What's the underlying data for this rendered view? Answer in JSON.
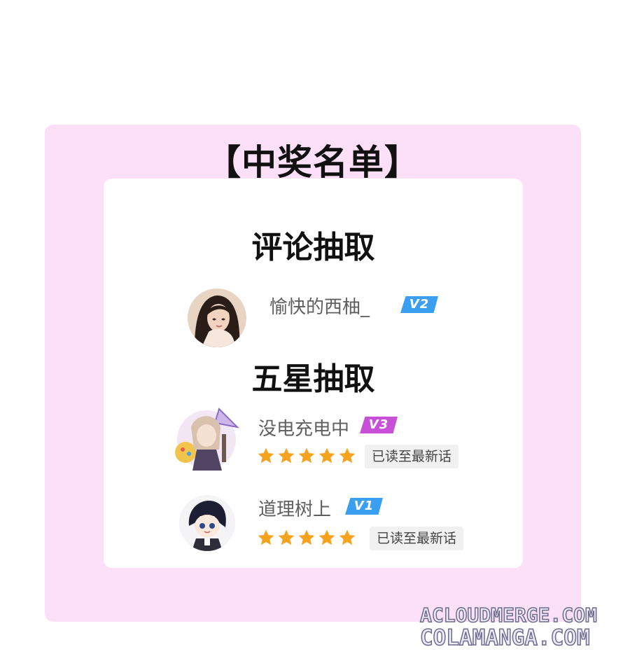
{
  "title": "【中奖名单】",
  "comment_draw": {
    "heading": "评论抽取",
    "winners": [
      {
        "name": "愉快的西柚_",
        "level": "V2",
        "level_color": "#3a9ff0",
        "avatar": "photo-avatar-icon"
      }
    ]
  },
  "star_draw": {
    "heading": "五星抽取",
    "winners": [
      {
        "name": "没电充电中",
        "level": "V3",
        "level_color": "#c84fd8",
        "rating": 5,
        "tag": "已读至最新话",
        "avatar": "anime-avatar-icon"
      },
      {
        "name": "道理树上",
        "level": "V1",
        "level_color": "#3a9ff0",
        "rating": 5,
        "tag": "已读至最新话",
        "avatar": "chibi-avatar-icon"
      }
    ]
  },
  "watermark": {
    "line1": "ACLOUDMERGE.COM",
    "line2": "COLAMANGA.COM"
  },
  "colors": {
    "panel_bg": "#fbe0f7",
    "star": "#f5a21f"
  }
}
